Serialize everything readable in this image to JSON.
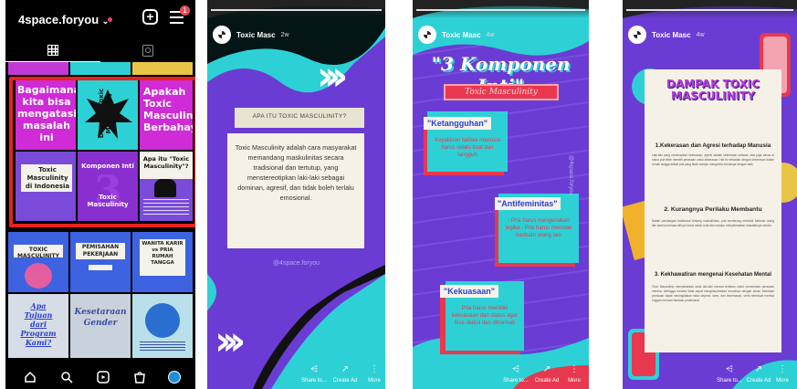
{
  "profile": {
    "username": "4space.foryou",
    "notification_count": "1"
  },
  "grid_tiles": {
    "t1": "Bagaimana kita bisa mengatasi masalah ini",
    "t2": "Dampak Toxic Masculinity",
    "t3": "Apakah Toxic Masculinity Berbahaya",
    "t4": "Toxic Masculinity di Indonesia",
    "t5a": "Komponen Inti",
    "t5b": "Toxic Masculinity",
    "t6": "Apa itu \"Toxic Masculinity\"?",
    "t7": "TOXIC MASCULINITY",
    "t8": "PEMISAHAN PEKERJAAN",
    "t9": "WANITA KARIR vs PRIA RUMAH TANGGA",
    "t10a": "Apa",
    "t10b": "Tujuan",
    "t10c": "dari",
    "t10d": "Program Kami?",
    "t11a": "Kesetaraan",
    "t11b": "Gender"
  },
  "story_common": {
    "account": "Toxic Masc",
    "share_label": "Share to...",
    "create_ad_label": "Create Ad",
    "more_label": "More"
  },
  "story1": {
    "time": "2w",
    "question": "APA ITU TOXIC MASCULINITY?",
    "body": "Toxic Masculinity adalah cara masyarakat memandang maskulinitas secara tradisional dan tertutup, yang menstereotipkan laki-laki sebagai dominan, agresif, dan tidak boleh terlalu emosional.",
    "watermark": "@4space.foryou"
  },
  "story2": {
    "time": "4w",
    "title": "\"3 Komponen Inti\"",
    "subtitle": "Toxic Masculinity",
    "c1_title": "\"Ketangguhan\"",
    "c1_body": "Keyakinan bahwa manusia harus selalu kuat dan tangguh",
    "c2_title": "\"Antifeminitas\"",
    "c2_body": "- Pria harus mengenakan logika - Pria harus menolak bantuan orang lain",
    "c3_title": "\"Kekuasaan\"",
    "c3_body": "Pria harus memiliki kekuasaan dan status agar bisa diakui dan dihormati",
    "watermark": "@4space.foryou"
  },
  "story3": {
    "time": "4w",
    "title": "DAMPAK TOXIC MASCULINITY",
    "h1": "1.Kekerasan dan Agresi terhadap Manusia",
    "p1": "Laki-laki yang menerapkan kekerasan, agresi adalah kekerasan seksual. Ada juga kasus di mana pria lebih memilih perasaan untuk kekerasan. Hal ini berkaitan dengan kekerasan dalam rumah tangga akibat pria yang tidak mampu mengelola emosinya dengan baik.",
    "h2": "2. Kurangnya Perilaku Membantu",
    "p2": "Dalam pandangan tradisional tentang maskulinitas, pria cenderung menolak bantuan orang lain karena merasa dirinya harus selalu kuat dan mampu menyelesaikan masalahnya sendiri.",
    "h3": "3. Kekhawatiran mengenai Kesehatan Mental",
    "p3": "Toxic Masculinity menyebabkan anak laki-laki merasa tertekan untuk memendam perasaan mereka, sehingga mereka tidak dapat mengekspresikan emosinya dengan sehat. Menekan perasaan dapat meningkatkan risiko depresi, stres, dan kecemasan, serta membuat mereka enggan mencari bantuan profesional."
  }
}
